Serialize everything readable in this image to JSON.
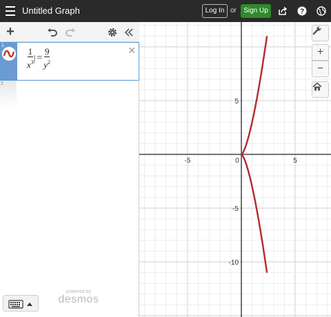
{
  "topbar": {
    "title": "Untitled Graph",
    "login_label": "Log In",
    "or_label": "or",
    "signup_label": "Sign Up"
  },
  "expressions": {
    "rows": [
      {
        "index": "1",
        "lhs_num": "1",
        "lhs_den_var": "x",
        "lhs_den_exp": "3",
        "bar": "|",
        "eq": "=",
        "rhs_num": "9",
        "rhs_den_var": "y",
        "rhs_den_exp": "2",
        "color": "#c0392b"
      },
      {
        "index": "2"
      }
    ]
  },
  "branding": {
    "powered_by": "powered by",
    "logo": "desmos"
  },
  "graph": {
    "x_ticks": [
      "-5",
      "0",
      "5"
    ],
    "y_ticks": [
      "5",
      "-5",
      "-10"
    ],
    "curve_color": "#b5302e",
    "axis_color": "#222222",
    "grid_minor_color": "#ececec",
    "grid_major_color": "#cfcfcf"
  },
  "icons": {
    "menu": "hamburger-menu-icon",
    "share": "share-icon",
    "help": "help-icon",
    "globe": "globe-icon",
    "add": "plus-icon",
    "undo": "undo-icon",
    "redo": "redo-icon",
    "settings": "gear-icon",
    "collapse": "double-chevron-left-icon",
    "wrench": "wrench-icon",
    "zoom_in": "plus-icon",
    "zoom_out": "minus-icon",
    "home": "home-icon",
    "keyboard": "keyboard-icon"
  }
}
